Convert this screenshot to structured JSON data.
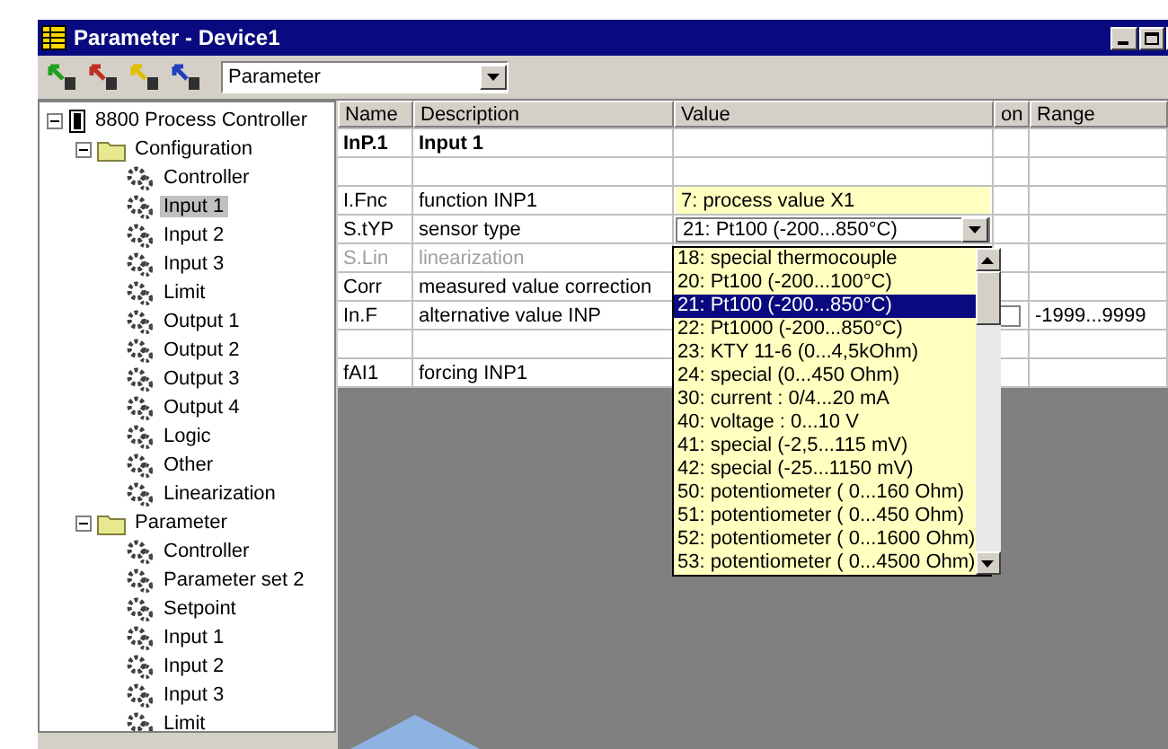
{
  "window": {
    "title": "Parameter - Device1"
  },
  "toolbar": {
    "buttons": [
      {
        "kind": "green"
      },
      {
        "kind": "red"
      },
      {
        "kind": "yellow"
      },
      {
        "kind": "blue"
      }
    ],
    "selector": {
      "value": "Parameter"
    }
  },
  "tree": {
    "label": "8800 Process Controller",
    "kind": "device",
    "expanded": true,
    "selected": false,
    "children": [
      {
        "label": "Configuration",
        "kind": "folder",
        "expanded": true,
        "selected": false,
        "children": [
          {
            "label": "Controller",
            "kind": "gear",
            "selected": false
          },
          {
            "label": "Input 1",
            "kind": "gear",
            "selected": true
          },
          {
            "label": "Input 2",
            "kind": "gear",
            "selected": false
          },
          {
            "label": "Input 3",
            "kind": "gear",
            "selected": false
          },
          {
            "label": "Limit",
            "kind": "gear",
            "selected": false
          },
          {
            "label": "Output 1",
            "kind": "gear",
            "selected": false
          },
          {
            "label": "Output 2",
            "kind": "gear",
            "selected": false
          },
          {
            "label": "Output 3",
            "kind": "gear",
            "selected": false
          },
          {
            "label": "Output 4",
            "kind": "gear",
            "selected": false
          },
          {
            "label": "Logic",
            "kind": "gear",
            "selected": false
          },
          {
            "label": "Other",
            "kind": "gear",
            "selected": false
          },
          {
            "label": "Linearization",
            "kind": "gear",
            "selected": false
          }
        ]
      },
      {
        "label": "Parameter",
        "kind": "folder",
        "expanded": true,
        "selected": false,
        "children": [
          {
            "label": "Controller",
            "kind": "gear",
            "selected": false
          },
          {
            "label": "Parameter set 2",
            "kind": "gear",
            "selected": false
          },
          {
            "label": "Setpoint",
            "kind": "gear",
            "selected": false
          },
          {
            "label": "Input 1",
            "kind": "gear",
            "selected": false
          },
          {
            "label": "Input 2",
            "kind": "gear",
            "selected": false
          },
          {
            "label": "Input 3",
            "kind": "gear",
            "selected": false
          },
          {
            "label": "Limit",
            "kind": "gear",
            "selected": false
          }
        ]
      }
    ]
  },
  "table": {
    "columns": [
      "Name",
      "Description",
      "Value",
      "on",
      "Range"
    ],
    "rows": [
      {
        "kind": "group",
        "name": "InP.1",
        "description": "Input 1"
      },
      {
        "kind": "blank"
      },
      {
        "kind": "param",
        "name": "I.Fnc",
        "description": "function INP1",
        "value": {
          "kind": "field",
          "text": "7: process value X1"
        },
        "disabled": false
      },
      {
        "kind": "param",
        "name": "S.tYP",
        "description": "sensor type",
        "value": {
          "kind": "combo",
          "text": "21: Pt100 (-200...850°C)"
        },
        "disabled": false
      },
      {
        "kind": "param",
        "name": "S.Lin",
        "description": "linearization",
        "disabled": true
      },
      {
        "kind": "param",
        "name": "Corr",
        "description": "measured value correction",
        "disabled": false
      },
      {
        "kind": "param",
        "name": "In.F",
        "description": "alternative value INP",
        "disabled": false,
        "on_checked": false,
        "range": "-1999...9999"
      },
      {
        "kind": "blank"
      },
      {
        "kind": "param",
        "name": "fAI1",
        "description": "forcing INP1",
        "disabled": false
      }
    ],
    "dropdown_list": [
      {
        "label": "18: special thermocouple",
        "selected": false
      },
      {
        "label": "20: Pt100 (-200...100°C)",
        "selected": false
      },
      {
        "label": "21: Pt100 (-200...850°C)",
        "selected": true
      },
      {
        "label": "22: Pt1000 (-200...850°C)",
        "selected": false
      },
      {
        "label": "23: KTY 11-6 (0...4,5kOhm)",
        "selected": false
      },
      {
        "label": "24: special (0...450 Ohm)",
        "selected": false
      },
      {
        "label": "30: current : 0/4...20 mA",
        "selected": false
      },
      {
        "label": "40: voltage : 0...10 V",
        "selected": false
      },
      {
        "label": "41: special (-2,5...115 mV)",
        "selected": false
      },
      {
        "label": "42: special (-25...1150 mV)",
        "selected": false
      },
      {
        "label": "50: potentiometer ( 0...160 Ohm)",
        "selected": false
      },
      {
        "label": "51: potentiometer ( 0...450 Ohm)",
        "selected": false
      },
      {
        "label": "52: potentiometer ( 0...1600 Ohm)",
        "selected": false
      },
      {
        "label": "53: potentiometer ( 0...4500 Ohm)",
        "selected": false
      }
    ]
  }
}
